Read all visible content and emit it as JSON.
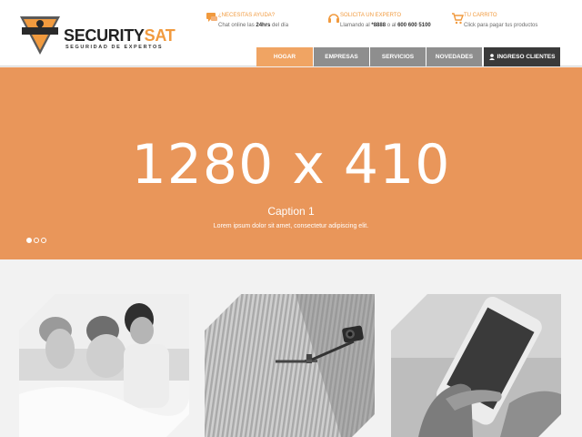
{
  "brand": {
    "name_part1": "SECURITY",
    "name_part2": "SAT",
    "tagline": "SEGURIDAD DE EXPERTOS",
    "badge_text": "SECURITYSAT",
    "accent_color": "#f19a3e"
  },
  "header_info": [
    {
      "icon": "chat-icon",
      "title": "¿NECESITAS AYUDA?",
      "line_pre": "Chat online las ",
      "line_bold": "24hrs",
      "line_post": " del día"
    },
    {
      "icon": "headset-icon",
      "title": "SOLICITA UN EXPERTO",
      "line_pre": "Llamando al ",
      "line_bold": "*8888",
      "line_mid": " o al ",
      "line_bold2": "600 600 5100"
    },
    {
      "icon": "cart-icon",
      "title": "TU CARRITO",
      "line_pre": "Click para pagar tus productos"
    }
  ],
  "nav": {
    "items": [
      "HOGAR",
      "EMPRESAS",
      "SERVICIOS",
      "NOVEDADES"
    ],
    "active": "HOGAR",
    "login_label": "INGRESO CLIENTES"
  },
  "hero": {
    "dimensions_text": "1280 x 410",
    "caption": "Caption 1",
    "subcaption": "Lorem ipsum dolor sit amet, consectetur adipiscing elit.",
    "background_color": "#e9965a",
    "slides_total": 3,
    "active_slide": 1
  },
  "tiles": [
    {
      "subject": "family-sleeping-photo"
    },
    {
      "subject": "security-camera-photo"
    },
    {
      "subject": "smartphone-hand-photo"
    }
  ]
}
